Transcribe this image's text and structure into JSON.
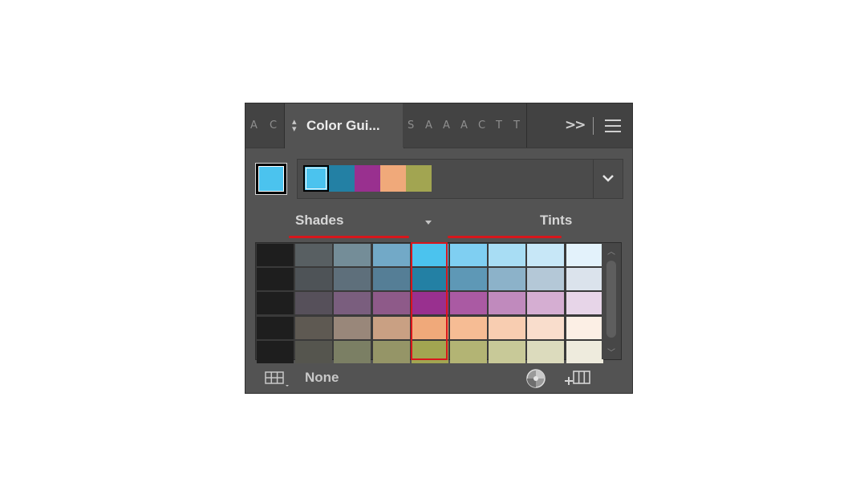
{
  "panel": {
    "active_tab_label": "Color Gui...",
    "stub_tabs": [
      "A",
      "C",
      "S",
      "A",
      "A",
      "A",
      "C",
      "T",
      "T"
    ],
    "more_label": ">>"
  },
  "current_color": "#4bc3ee",
  "harmony": {
    "swatches": [
      "#4bc3ee",
      "#2380a4",
      "#99308f",
      "#f0a97a",
      "#a2a551"
    ]
  },
  "labels": {
    "shades": "Shades",
    "tints": "Tints"
  },
  "grid": {
    "rows": [
      [
        "#1e1e1e",
        "#585f62",
        "#748d98",
        "#72a9c7",
        "#4bc3ee",
        "#7fcff2",
        "#a8ddf4",
        "#c7e7f7",
        "#e3f2fb"
      ],
      [
        "#1e1e1e",
        "#4e5357",
        "#5e6f7b",
        "#557e96",
        "#2380a4",
        "#5e98b6",
        "#8cb2c9",
        "#b4c8d7",
        "#dbe3ec"
      ],
      [
        "#1e1e1e",
        "#56505a",
        "#7a5e7e",
        "#8e5a89",
        "#99308f",
        "#aa5aa3",
        "#c08abd",
        "#d5aed2",
        "#e7d5e8"
      ],
      [
        "#1e1e1e",
        "#5e5952",
        "#99877a",
        "#c9a083",
        "#f0a97a",
        "#f6bc94",
        "#f8cdb1",
        "#f9ddcc",
        "#fcefe5"
      ],
      [
        "#1e1e1e",
        "#55554e",
        "#7b7f64",
        "#959567",
        "#a2a551",
        "#b3b474",
        "#c8c998",
        "#dcdbbd",
        "#eeebdd"
      ]
    ]
  },
  "footer": {
    "none_label": "None"
  },
  "icons": {
    "menu": "hamburger-menu-icon",
    "dropdown": "chevron-down-icon",
    "library": "swatch-library-icon",
    "globe": "color-wheel-icon",
    "save": "save-to-swatches-icon"
  }
}
